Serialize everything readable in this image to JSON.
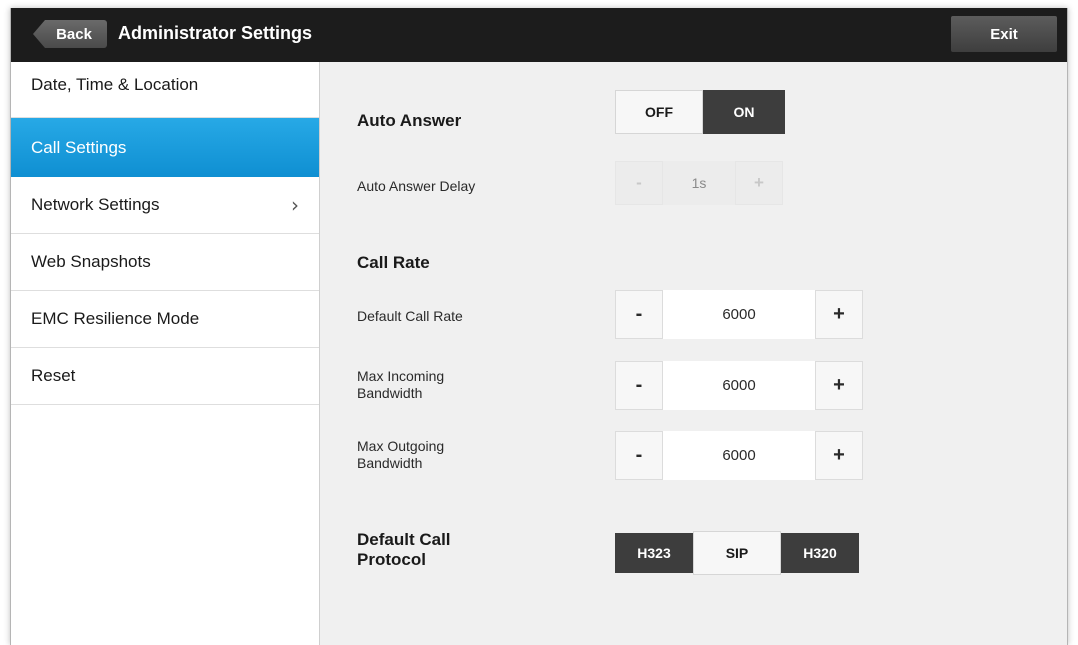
{
  "header": {
    "back_label": "Back",
    "title": "Administrator Settings",
    "exit_label": "Exit"
  },
  "sidebar": {
    "items": [
      {
        "label": "Date, Time & Location"
      },
      {
        "label": "Call Settings",
        "active": true
      },
      {
        "label": "Network Settings",
        "has_submenu": true
      },
      {
        "label": "Web Snapshots"
      },
      {
        "label": "EMC Resilience Mode"
      },
      {
        "label": "Reset"
      }
    ],
    "chevron": "›"
  },
  "main": {
    "auto_answer": {
      "label": "Auto Answer",
      "off_label": "OFF",
      "on_label": "ON",
      "value": "ON"
    },
    "auto_answer_delay": {
      "label": "Auto Answer Delay",
      "minus": "-",
      "value": "1s",
      "plus": "+"
    },
    "call_rate": {
      "heading": "Call Rate",
      "rows": [
        {
          "label": "Default Call Rate",
          "minus": "-",
          "value": "6000",
          "plus": "+"
        },
        {
          "label": "Max Incoming Bandwidth",
          "minus": "-",
          "value": "6000",
          "plus": "+"
        },
        {
          "label": "Max Outgoing Bandwidth",
          "minus": "-",
          "value": "6000",
          "plus": "+"
        }
      ]
    },
    "protocol": {
      "label": "Default Call Protocol",
      "options": [
        "H323",
        "SIP",
        "H320"
      ],
      "selected": "SIP"
    }
  },
  "colors": {
    "header_bg": "#1c1c1c",
    "active_item": "#1a9ad9",
    "content_bg": "#f0f0f0",
    "segment_dark": "#3d3d3d"
  }
}
